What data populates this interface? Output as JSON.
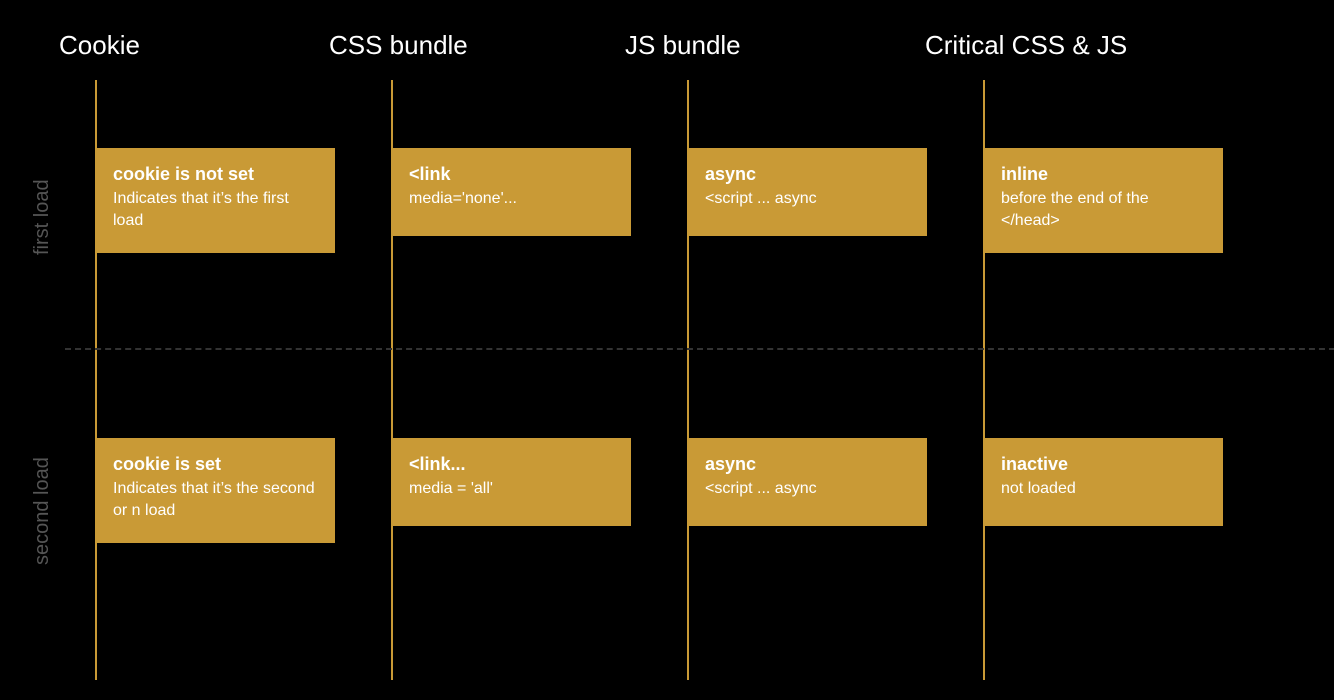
{
  "columns": [
    {
      "label": "Cookie"
    },
    {
      "label": "CSS bundle"
    },
    {
      "label": "JS bundle"
    },
    {
      "label": "Critical CSS & JS"
    }
  ],
  "rows": [
    {
      "label": "first load"
    },
    {
      "label": "second load"
    }
  ],
  "cells": {
    "r0c0": {
      "title": "cookie is not set",
      "desc": "Indicates that it’s the first load"
    },
    "r0c1": {
      "title": "<link",
      "desc": "media='none'..."
    },
    "r0c2": {
      "title": "async",
      "desc": "<script ... async"
    },
    "r0c3": {
      "title": "inline",
      "desc": "before the end of the </head>"
    },
    "r1c0": {
      "title": "cookie is set",
      "desc": "Indicates that it’s the second or n load"
    },
    "r1c1": {
      "title": "<link...",
      "desc": "media = 'all'"
    },
    "r1c2": {
      "title": "async",
      "desc": "<script ... async"
    },
    "r1c3": {
      "title": "inactive",
      "desc": "not loaded"
    }
  },
  "colors": {
    "card": "#c99a36",
    "bg": "#000000"
  }
}
